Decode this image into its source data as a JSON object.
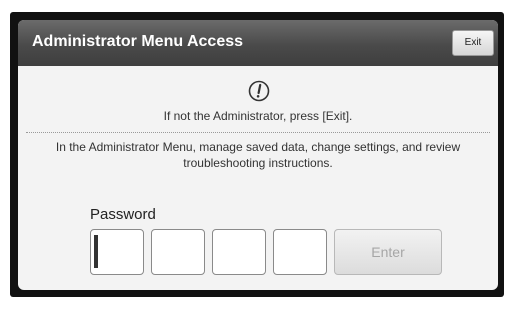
{
  "dialog": {
    "title": "Administrator Menu Access",
    "exit_label": "Exit",
    "info_icon": "exclamation-circle-icon",
    "info_text": "If not the Administrator, press [Exit].",
    "description": "In the Administrator Menu, manage saved data, change settings, and review troubleshooting instructions."
  },
  "password": {
    "label": "Password",
    "digits": [
      "",
      "",
      "",
      ""
    ],
    "enter_label": "Enter",
    "enter_enabled": false
  },
  "colors": {
    "header_bg": "#4a4a4a",
    "dialog_bg": "#f3f3f3",
    "disabled_text": "#a6a6a6"
  }
}
